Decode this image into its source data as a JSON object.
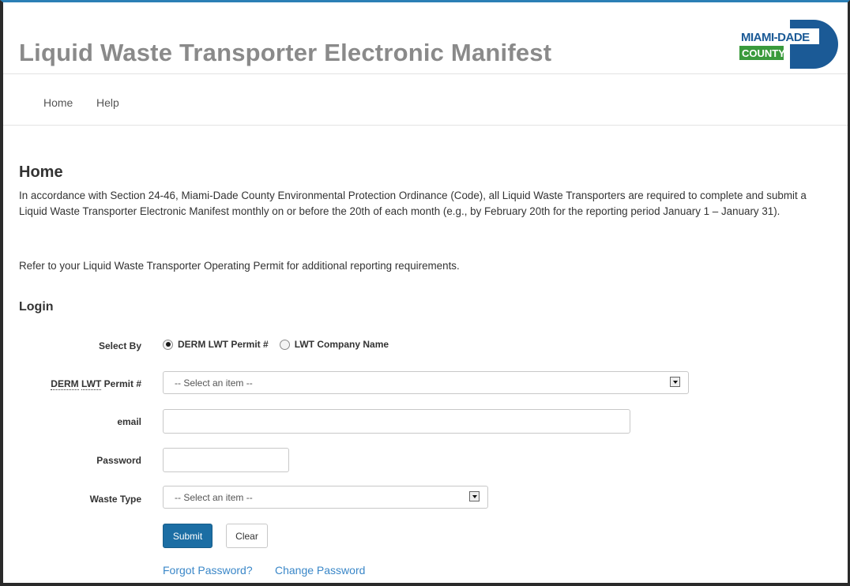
{
  "header": {
    "title": "Liquid Waste Transporter Electronic Manifest",
    "logo_line1": "MIAMI-DADE",
    "logo_line2": "COUNTY",
    "logo_blue": "#1b5a96",
    "logo_green": "#3a9a3c"
  },
  "nav": {
    "items": [
      {
        "label": "Home"
      },
      {
        "label": "Help"
      }
    ]
  },
  "main": {
    "heading": "Home",
    "intro": "In accordance with Section 24-46, Miami-Dade County Environmental Protection Ordinance (Code), all Liquid Waste Transporters are required to complete and submit a Liquid Waste Transporter Electronic Manifest monthly on or before the 20th of each month (e.g., by February 20th for the reporting period January 1 – January 31).",
    "refer": "Refer to your Liquid Waste Transporter Operating Permit for additional reporting requirements."
  },
  "login": {
    "heading": "Login",
    "select_by_label": "Select By",
    "option_permit": "DERM LWT Permit #",
    "option_company": "LWT Company Name",
    "selected_option": "DERM LWT Permit #",
    "permit_label_part1": "DERM",
    "permit_label_part2": "LWT",
    "permit_label_part3": "Permit #",
    "permit_select_value": "-- Select an item --",
    "email_label": "email",
    "email_value": "",
    "password_label": "Password",
    "password_value": "",
    "waste_type_label": "Waste Type",
    "waste_type_value": "-- Select an item --",
    "submit_label": "Submit",
    "clear_label": "Clear",
    "forgot_password": "Forgot Password?",
    "change_password": "Change Password"
  },
  "colors": {
    "accent": "#1c6ea4",
    "link": "#3a87c8",
    "title": "#8a8a8a"
  }
}
